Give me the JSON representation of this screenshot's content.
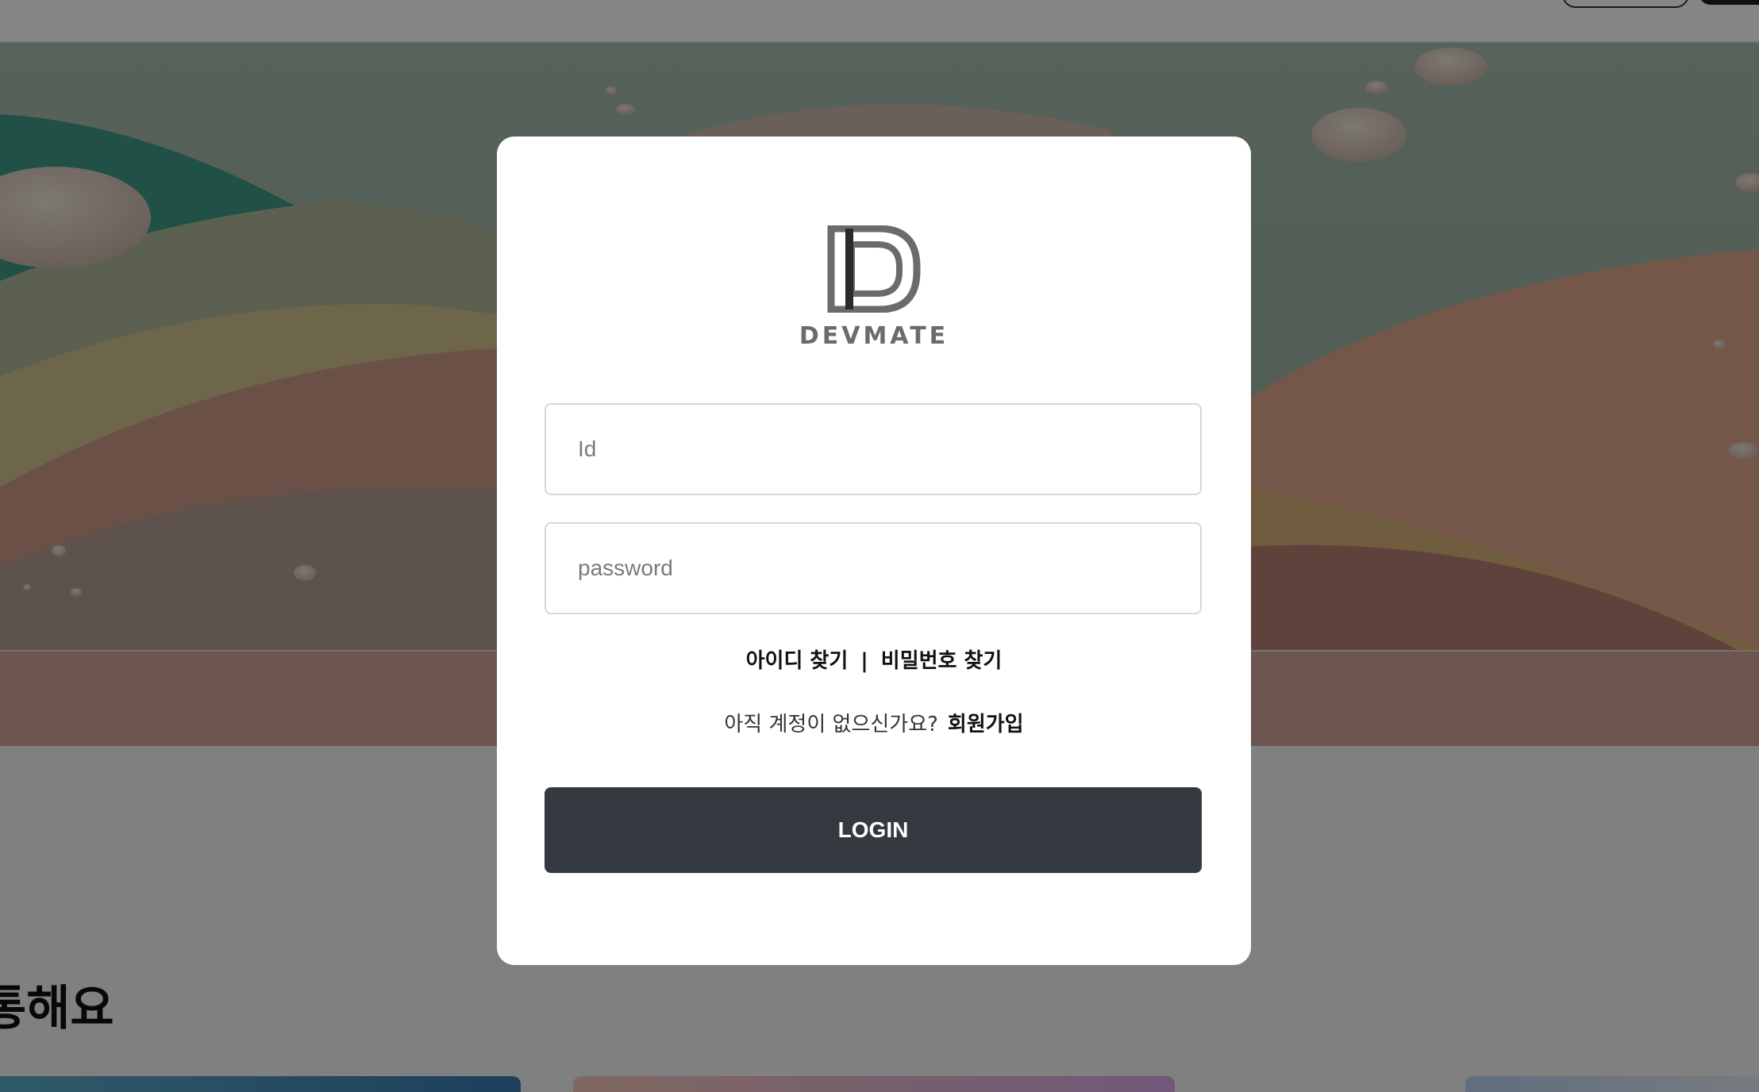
{
  "background": {
    "section_title": "통해요"
  },
  "login_modal": {
    "logo_text": "DEVMATE",
    "id_placeholder": "Id",
    "password_placeholder": "password",
    "find_id_label": "아이디 찾기",
    "separator": "|",
    "find_password_label": "비밀번호 찾기",
    "no_account_text": "아직 계정이 없으신가요?",
    "signup_label": "회원가입",
    "login_button_label": "LOGIN"
  },
  "colors": {
    "login_button": "#343a3f",
    "overlay": "rgba(0,0,0,0.48)",
    "modal_background": "#ffffff"
  },
  "icons": [
    "devmate-logo-icon"
  ]
}
